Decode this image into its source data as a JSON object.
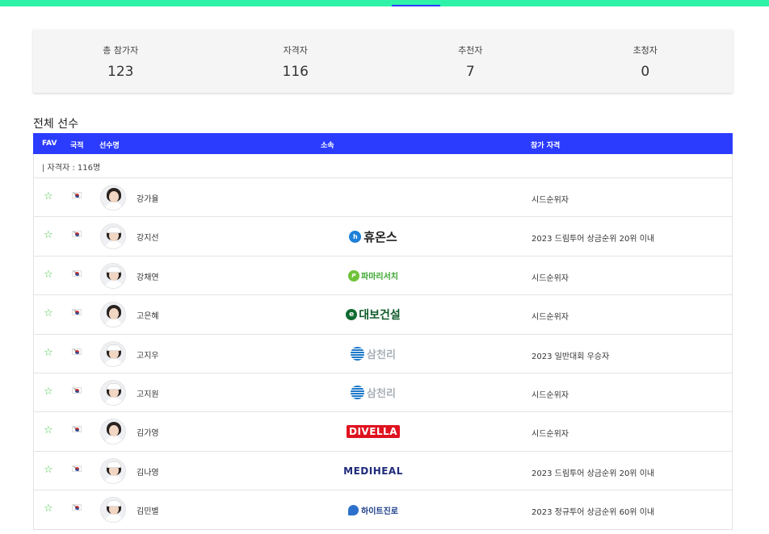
{
  "stats": [
    {
      "label": "총 참가자",
      "value": "123"
    },
    {
      "label": "자격자",
      "value": "116"
    },
    {
      "label": "추천자",
      "value": "7"
    },
    {
      "label": "초청자",
      "value": "0"
    }
  ],
  "section_title": "전체 선수",
  "table": {
    "headers": {
      "fav": "FAV",
      "nationality": "국적",
      "name": "선수명",
      "affiliation": "소속",
      "qualification": "참가 자격"
    },
    "group_label": "| 자격자 : 116명",
    "rows": [
      {
        "name": "강가율",
        "affiliation": "",
        "logo": "none",
        "qualification": "시드순위자"
      },
      {
        "name": "강지선",
        "affiliation": "휴온스",
        "logo": "huons",
        "qualification": "2023 드림투어 상금순위 20위 이내"
      },
      {
        "name": "강채연",
        "affiliation": "파마리서치",
        "logo": "pharm",
        "qualification": "시드순위자"
      },
      {
        "name": "고은혜",
        "affiliation": "대보건설",
        "logo": "daebo",
        "qualification": "시드순위자"
      },
      {
        "name": "고지우",
        "affiliation": "삼천리",
        "logo": "samch",
        "qualification": "2023 일반대회 우승자"
      },
      {
        "name": "고지원",
        "affiliation": "삼천리",
        "logo": "samch",
        "qualification": "시드순위자"
      },
      {
        "name": "김가영",
        "affiliation": "DIVELLA",
        "logo": "divella",
        "qualification": "시드순위자"
      },
      {
        "name": "김나영",
        "affiliation": "MEDIHEAL",
        "logo": "medi",
        "qualification": "2023 드림투어 상금순위 20위 이내"
      },
      {
        "name": "김민별",
        "affiliation": "하이트진로",
        "logo": "hite",
        "qualification": "2023 정규투어 상금순위 60위 이내"
      }
    ]
  },
  "icons": {
    "favorite": "star-outline-icon",
    "flag": "korea-flag-icon"
  },
  "colors": {
    "accent_top": "#2ef2a8",
    "header_blue": "#2b3cff",
    "star_green": "#4cc94c"
  }
}
